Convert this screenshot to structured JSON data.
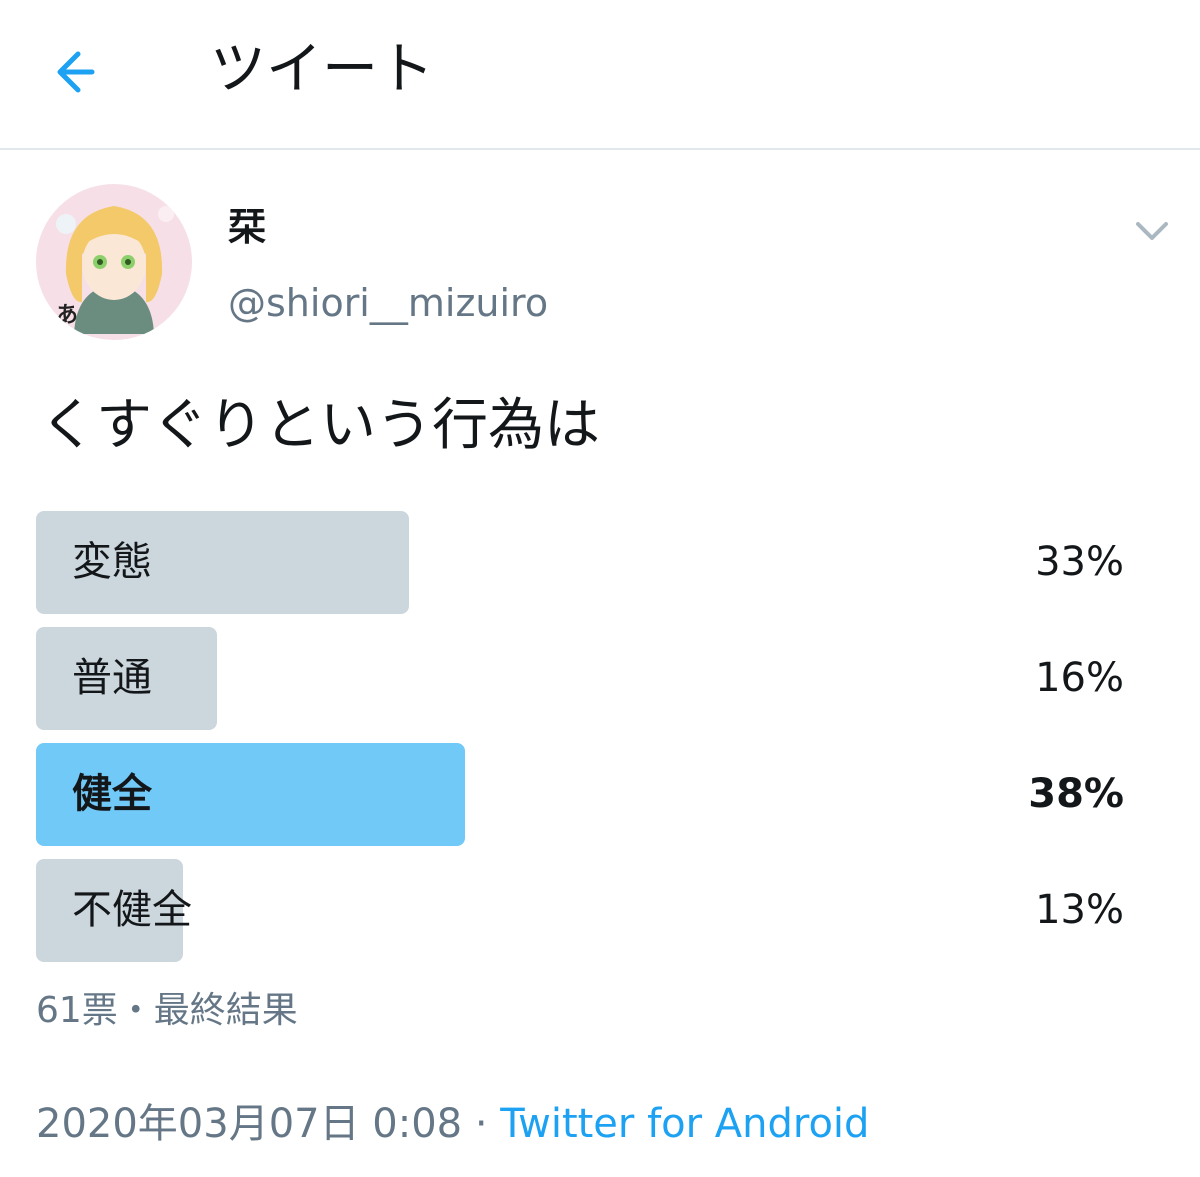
{
  "header": {
    "title": "ツイート",
    "back_icon": "arrow-left-icon"
  },
  "colors": {
    "accent": "#1da1f2",
    "secondary_text": "#657786",
    "poll_bar": "#ccd6dd",
    "poll_bar_winner": "#71c9f8"
  },
  "author": {
    "display_name": "栞",
    "username": "@shiori__mizuiro",
    "avatar_icon": "profile-avatar",
    "avatar_text": "あ",
    "menu_icon": "chevron-down-icon"
  },
  "tweet": {
    "text": "くすぐりという行為は"
  },
  "poll": {
    "options": [
      {
        "label": "変態",
        "percent_text": "33%",
        "percent": 33,
        "winner": false
      },
      {
        "label": "普通",
        "percent_text": "16%",
        "percent": 16,
        "winner": false
      },
      {
        "label": "健全",
        "percent_text": "38%",
        "percent": 38,
        "winner": true
      },
      {
        "label": "不健全",
        "percent_text": "13%",
        "percent": 13,
        "winner": false
      }
    ],
    "meta": "61票・最終結果"
  },
  "footer": {
    "timestamp": "2020年03月07日 0:08",
    "separator": " · ",
    "source": "Twitter for Android"
  }
}
